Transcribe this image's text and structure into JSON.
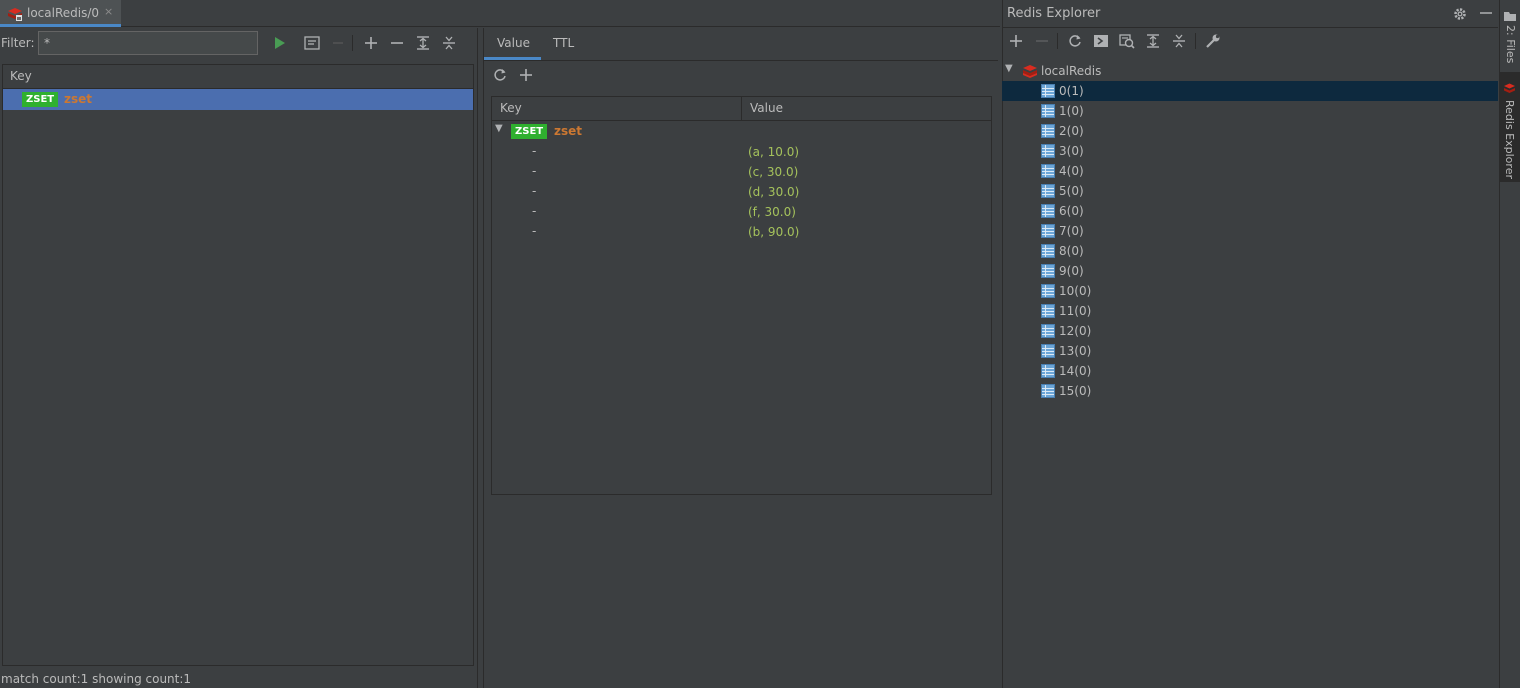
{
  "editor_tab": {
    "title": "localRedis/0",
    "close": "×",
    "icon": "redis-icon"
  },
  "filter": {
    "label": "Filter:",
    "value": "*"
  },
  "key_table": {
    "header": "Key",
    "rows": [
      {
        "type": "ZSET",
        "name": "zset"
      }
    ]
  },
  "status_bar": {
    "text": "match count:1 showing count:1"
  },
  "value_panel": {
    "tabs": [
      "Value",
      "TTL"
    ],
    "active_tab": "Value",
    "columns": [
      "Key",
      "Value"
    ],
    "root": {
      "type": "ZSET",
      "name": "zset"
    },
    "rows": [
      {
        "key": "-",
        "value": "(a, 10.0)"
      },
      {
        "key": "-",
        "value": "(c, 30.0)"
      },
      {
        "key": "-",
        "value": "(d, 30.0)"
      },
      {
        "key": "-",
        "value": "(f, 30.0)"
      },
      {
        "key": "-",
        "value": "(b, 90.0)"
      }
    ]
  },
  "explorer": {
    "title": "Redis Explorer",
    "connection": "localRedis",
    "databases": [
      "0(1)",
      "1(0)",
      "2(0)",
      "3(0)",
      "4(0)",
      "5(0)",
      "6(0)",
      "7(0)",
      "8(0)",
      "9(0)",
      "10(0)",
      "11(0)",
      "12(0)",
      "13(0)",
      "14(0)",
      "15(0)"
    ],
    "selected": "0(1)"
  },
  "side_stripe": {
    "files": "2: Files",
    "redis": "Redis Explorer"
  },
  "colors": {
    "accent": "#4a88c7",
    "selection": "#4b6eaf",
    "badge": "#2fb02f",
    "key": "#cc7832",
    "value": "#a5c25c",
    "tree_selection": "#0d293e"
  }
}
